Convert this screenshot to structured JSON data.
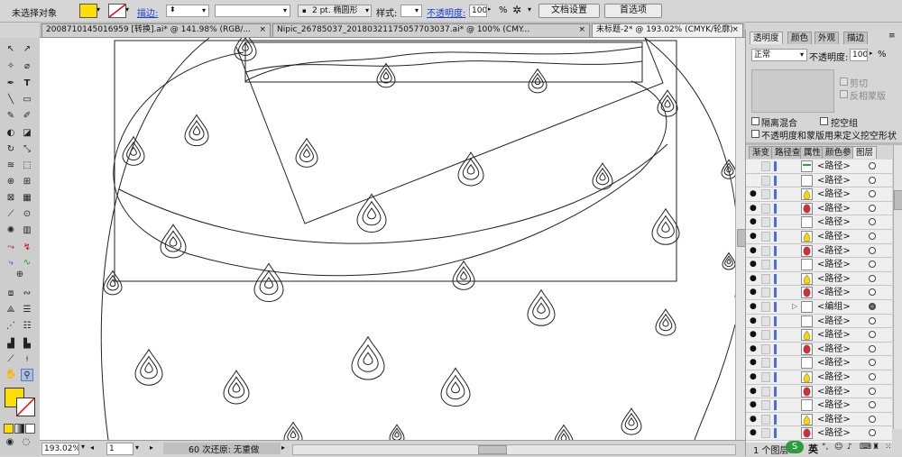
{
  "control_bar": {
    "selection_label": "未选择对象",
    "fill_color": "#ffdd00",
    "stroke_label": "描边:",
    "stroke_width": "",
    "brush_label": "2 pt. 椭圆形",
    "style_label": "样式:",
    "opacity_label": "不透明度:",
    "opacity_value": "100",
    "opacity_unit": "%",
    "doc_setup_button": "文档设置",
    "preferences_button": "首选项"
  },
  "tabs": [
    {
      "label": "20087101450169​59 [转换].ai* @ 141.98% (RGB/...",
      "close": "×"
    },
    {
      "label": "Nipic_26785037_20180321175057703037.ai* @ 100% (CMY...",
      "close": "×"
    },
    {
      "label": "未标题-2* @ 193.02% (CMYK/轮廓)",
      "close": "×"
    }
  ],
  "tools": {
    "fill_color": "#ffdd00"
  },
  "status_bar": {
    "zoom": "193.02%",
    "artboard": "1",
    "history": "60 次还原: 无重做"
  },
  "transparency_panel": {
    "tabs": [
      "透明度",
      "颜色",
      "外观",
      "描边"
    ],
    "blend_mode": "正常",
    "opacity_label": "不透明度:",
    "opacity_value": "100",
    "opacity_unit": "%",
    "clip_label": "剪切",
    "invert_mask_label": "反相蒙版",
    "isolate_blending": "隔离混合",
    "knockout_group": "挖空组",
    "opacity_mask_define": "不透明度和蒙版用来定义挖空形状"
  },
  "layers_panel": {
    "tabs": [
      "渐变",
      "路径查",
      "属性",
      "颜色参",
      "图层"
    ],
    "footer": "1 个图层",
    "rows": [
      {
        "name": "<路径>",
        "thumb": "green",
        "visible": false
      },
      {
        "name": "<路径>",
        "thumb": "white",
        "visible": false
      },
      {
        "name": "<路径>",
        "thumb": "yellow",
        "visible": true
      },
      {
        "name": "<路径>",
        "thumb": "red",
        "visible": true
      },
      {
        "name": "<路径>",
        "thumb": "white",
        "visible": true
      },
      {
        "name": "<路径>",
        "thumb": "yellow",
        "visible": true
      },
      {
        "name": "<路径>",
        "thumb": "red",
        "visible": true
      },
      {
        "name": "<路径>",
        "thumb": "white",
        "visible": true
      },
      {
        "name": "<路径>",
        "thumb": "yellow",
        "visible": true
      },
      {
        "name": "<路径>",
        "thumb": "red",
        "visible": true
      },
      {
        "name": "<编组>",
        "thumb": "white",
        "visible": true,
        "expandable": true,
        "target": true
      },
      {
        "name": "<路径>",
        "thumb": "white",
        "visible": true
      },
      {
        "name": "<路径>",
        "thumb": "yellow",
        "visible": true
      },
      {
        "name": "<路径>",
        "thumb": "red",
        "visible": true
      },
      {
        "name": "<路径>",
        "thumb": "white",
        "visible": true
      },
      {
        "name": "<路径>",
        "thumb": "yellow",
        "visible": true
      },
      {
        "name": "<路径>",
        "thumb": "red",
        "visible": true
      },
      {
        "name": "<路径>",
        "thumb": "white",
        "visible": true
      },
      {
        "name": "<路径>",
        "thumb": "yellow",
        "visible": true
      },
      {
        "name": "<路径>",
        "thumb": "red",
        "visible": true
      }
    ]
  },
  "ime": {
    "label": "英"
  }
}
